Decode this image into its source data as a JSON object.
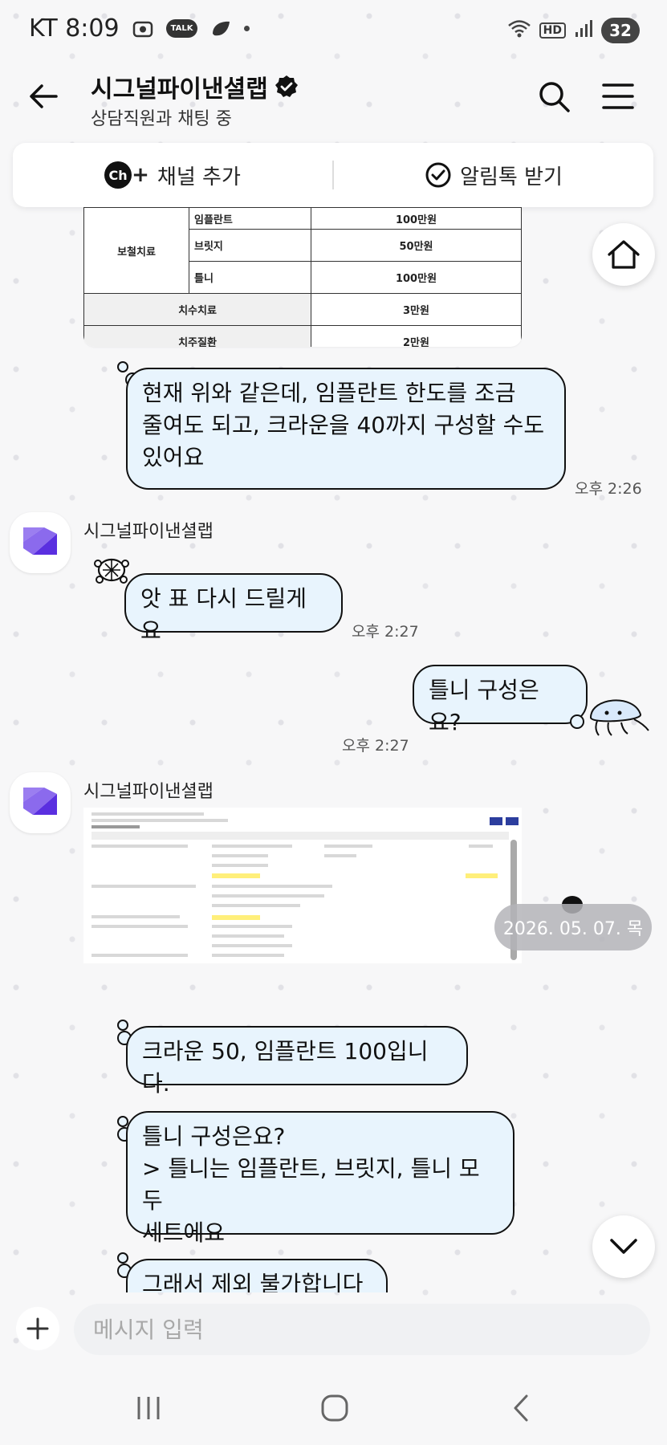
{
  "status_bar": {
    "carrier_time": "KT 8:09",
    "talk_label": "TALK",
    "hd_label": "HD",
    "battery": "32"
  },
  "header": {
    "title": "시그널파이낸셜랩",
    "subtitle": "상담직원과 채팅 중"
  },
  "channel_bar": {
    "add_channel": "채널 추가",
    "ch_label": "Ch",
    "alimtalk": "알림톡 받기"
  },
  "table": {
    "group_label": "보철치료",
    "rows": [
      {
        "item": "임플란트",
        "amount": "100만원"
      },
      {
        "item": "브릿지",
        "amount": "50만원"
      },
      {
        "item": "틀니",
        "amount": "100만원"
      },
      {
        "item": "치수치료",
        "amount": "3만원"
      },
      {
        "item": "치주질환",
        "amount": "2만원"
      }
    ]
  },
  "messages": {
    "m1_line1": "현재 위와 같은데, 임플란트 한도를 조금",
    "m1_line2": "줄여도 되고, 크라운을 40까지 구성할 수도",
    "m1_line3": "있어요",
    "m1_time": "오후 2:26",
    "sender1": "시그널파이낸셜랩",
    "m2": "앗 표 다시 드릴게요",
    "m2_time": "오후 2:27",
    "m3": "틀니 구성은요?",
    "m3_time": "오후 2:27",
    "sender2": "시그널파이낸셜랩",
    "m4": "크라운 50, 임플란트 100입니다.",
    "m5_line1": "틀니 구성은요?",
    "m5_line2": "> 틀니는 임플란트, 브릿지, 틀니 모두",
    "m5_line3": "세트에요",
    "m6_partial": "그래서 제외 불가합니다"
  },
  "date_pill": "2026. 05. 07. 목",
  "input": {
    "placeholder": "메시지 입력"
  },
  "colors": {
    "bubble_bg": "#e8f4fd",
    "brand_purple": "#6a3de8"
  }
}
